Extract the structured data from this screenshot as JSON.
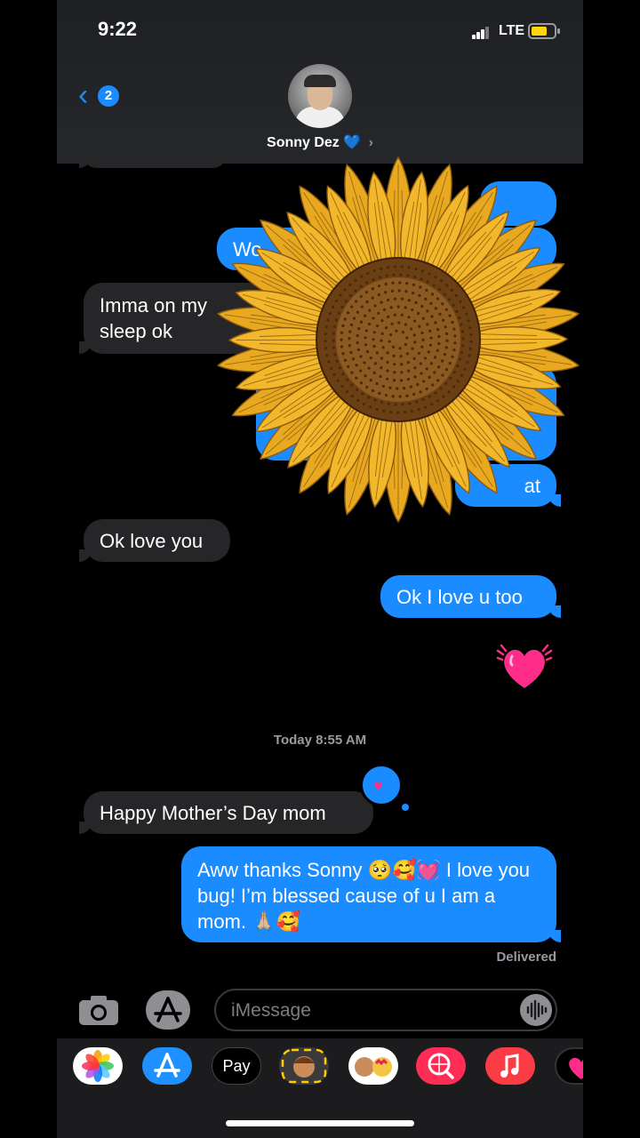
{
  "status": {
    "time": "9:22",
    "network": "LTE"
  },
  "nav": {
    "back_badge": "2",
    "contact_name": "Sonny Dez",
    "contact_emoji": "💙",
    "arrow": "›"
  },
  "messages": {
    "partial_out_1": "Wo",
    "in_1_line1": "Imma on my",
    "in_1_line2": "sleep ok",
    "partial_out_2": "at",
    "in_2": "Ok love you",
    "out_1": "Ok I love u too",
    "timestamp": "Today 8:55 AM",
    "in_3": "Happy Mother’s Day mom",
    "out_2": "Aww thanks Sonny 🥺🥰💓 I love you bug! I’m blessed cause of u I am a mom. 🙏🏼🥰",
    "delivered": "Delivered"
  },
  "input": {
    "placeholder": "iMessage"
  },
  "drawer": {
    "apps": [
      "photos-app",
      "appstore-app",
      "applepay-app",
      "memoji-app",
      "animoji-stickers-app",
      "images-search-app",
      "music-app",
      "digital-touch-app"
    ],
    "applepay_label": "Pay"
  },
  "colors": {
    "outgoing": "#1a8cff",
    "incoming": "#262628",
    "heart": "#ff2d8a",
    "sunflower_petal": "#f2b72a",
    "sunflower_center": "#6b3f14"
  }
}
